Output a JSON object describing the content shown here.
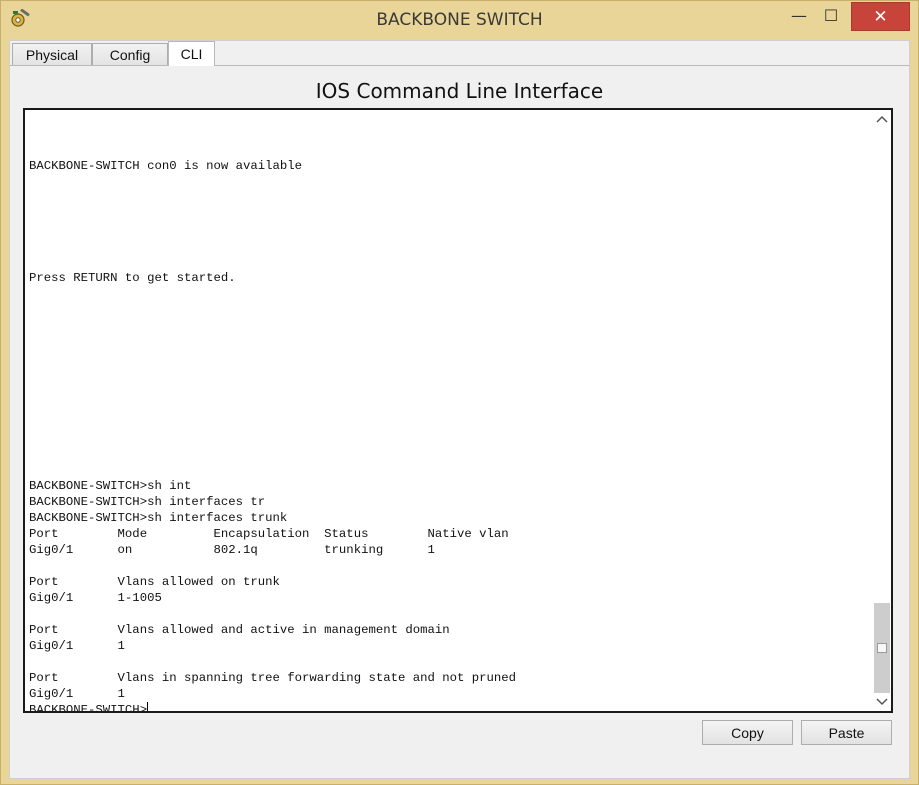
{
  "window": {
    "title": "BACKBONE SWITCH",
    "controls": {
      "minimize": "—",
      "maximize": "☐",
      "close": "✕"
    },
    "icon": "gear-wrench-icon"
  },
  "tabs": [
    {
      "label": "Physical",
      "active": false
    },
    {
      "label": "Config",
      "active": false
    },
    {
      "label": "CLI",
      "active": true
    }
  ],
  "cli": {
    "heading": "IOS Command Line Interface",
    "lines": [
      {
        "row": 3,
        "text": "BACKBONE-SWITCH con0 is now available"
      },
      {
        "row": 10,
        "text": "Press RETURN to get started."
      },
      {
        "row": 23,
        "text": "BACKBONE-SWITCH>sh int"
      },
      {
        "row": 24,
        "text": "BACKBONE-SWITCH>sh interfaces tr"
      },
      {
        "row": 25,
        "text": "BACKBONE-SWITCH>sh interfaces trunk"
      },
      {
        "row": 26,
        "text": "Port        Mode         Encapsulation  Status        Native vlan"
      },
      {
        "row": 27,
        "text": "Gig0/1      on           802.1q         trunking      1"
      },
      {
        "row": 29,
        "text": "Port        Vlans allowed on trunk"
      },
      {
        "row": 30,
        "text": "Gig0/1      1-1005"
      },
      {
        "row": 32,
        "text": "Port        Vlans allowed and active in management domain"
      },
      {
        "row": 33,
        "text": "Gig0/1      1"
      },
      {
        "row": 35,
        "text": "Port        Vlans in spanning tree forwarding state and not pruned"
      },
      {
        "row": 36,
        "text": "Gig0/1      1"
      },
      {
        "row": 37,
        "text": "BACKBONE-SWITCH>"
      }
    ],
    "scroll_position": 1.0,
    "scroll_visible_fraction": 0.16
  },
  "buttons": {
    "copy": "Copy",
    "paste": "Paste"
  },
  "colors": {
    "window_frame": "#e9d597",
    "close_button": "#c7443a",
    "terminal_bg": "#ffffff"
  }
}
